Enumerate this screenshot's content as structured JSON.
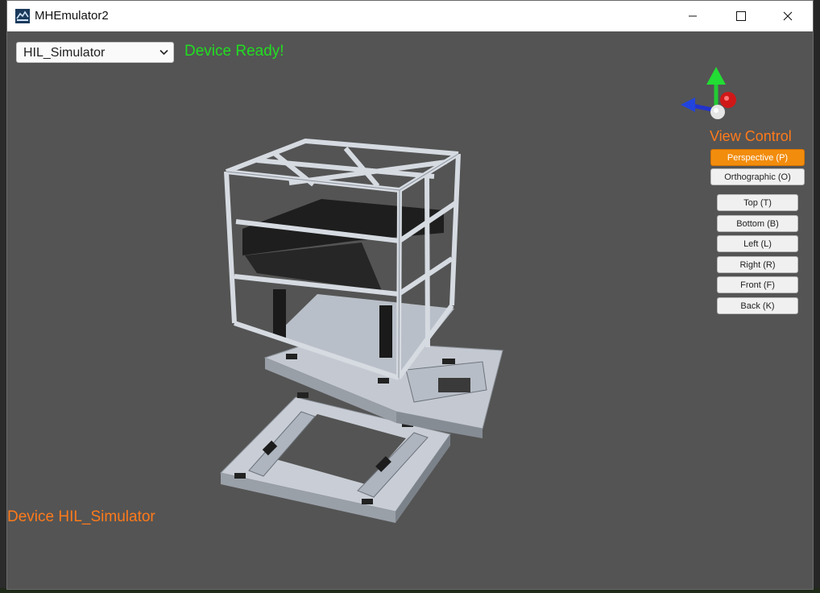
{
  "window": {
    "title": "MHEmulator2"
  },
  "toolbar": {
    "device_select_value": "HIL_Simulator",
    "status_text": "Device Ready!",
    "status_color": "#22dd22"
  },
  "view_control": {
    "title": "View Control",
    "projection_buttons": [
      {
        "label": "Perspective (P)",
        "active": true
      },
      {
        "label": "Orthographic (O)",
        "active": false
      }
    ],
    "view_buttons": [
      {
        "label": "Top (T)"
      },
      {
        "label": "Bottom (B)"
      },
      {
        "label": "Left (L)"
      },
      {
        "label": "Right (R)"
      },
      {
        "label": "Front (F)"
      },
      {
        "label": "Back (K)"
      }
    ],
    "accent_color": "#f28c0c"
  },
  "footer": {
    "device_label": "Device HIL_Simulator"
  },
  "icons": {
    "app": "motion-house-logo-icon",
    "minimize": "minimize-icon",
    "maximize": "maximize-icon",
    "close": "close-icon",
    "dropdown": "chevron-down-icon",
    "orientation_gizmo": "axis-gizmo-icon"
  }
}
